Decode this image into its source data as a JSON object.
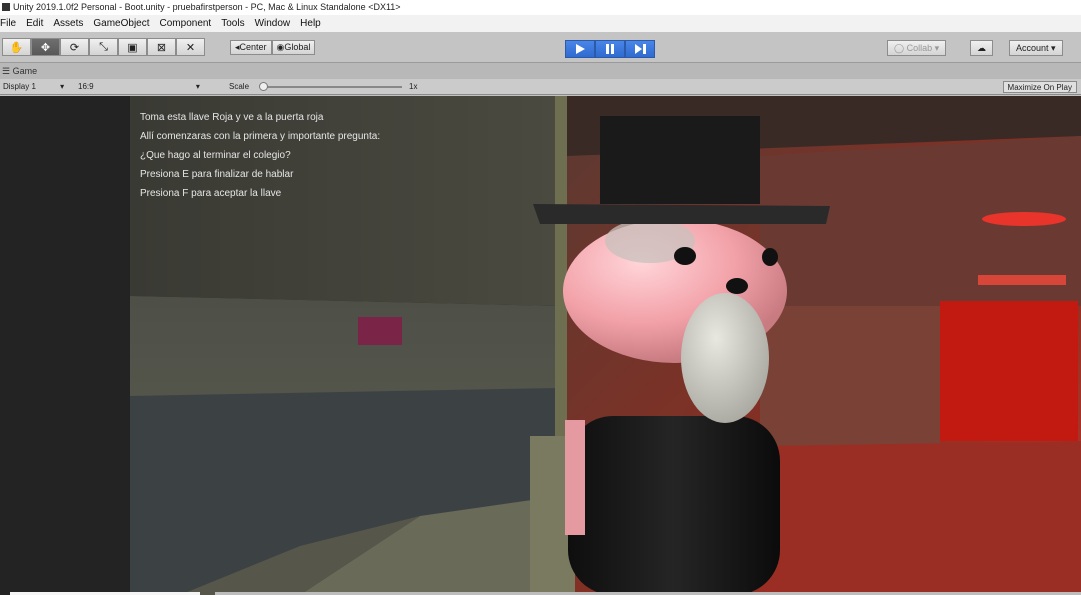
{
  "window": {
    "title": "Unity 2019.1.0f2 Personal - Boot.unity - pruebafirstperson - PC, Mac & Linux Standalone <DX11>"
  },
  "menu": [
    "File",
    "Edit",
    "Assets",
    "GameObject",
    "Component",
    "Tools",
    "Window",
    "Help"
  ],
  "toolbar": {
    "tools": [
      {
        "name": "hand-tool",
        "glyph": "✋"
      },
      {
        "name": "move-tool",
        "glyph": "✥"
      },
      {
        "name": "rotate-tool",
        "glyph": "⟳"
      },
      {
        "name": "scale-tool",
        "glyph": "⤡"
      },
      {
        "name": "rect-tool",
        "glyph": "▣"
      },
      {
        "name": "transform-tool",
        "glyph": "⊠"
      },
      {
        "name": "custom-tool",
        "glyph": "✕"
      }
    ],
    "active_tool_index": 1,
    "pivot_label": "Center",
    "space_label": "Global",
    "collab_label": "Collab",
    "account_label": "Account"
  },
  "tabs": {
    "game_tab": "Game"
  },
  "gamebar": {
    "display": "Display 1",
    "aspect": "16:9",
    "scale_label": "Scale",
    "scale_value": "1x",
    "maximize": "Maximize On Play"
  },
  "dialog": {
    "lines": [
      "Toma esta llave Roja y ve a la puerta roja",
      "Allí comenzaras con la primera y importante pregunta:",
      "¿Que hago al terminar el colegio?",
      "Presiona E para finalizar de hablar",
      "Presiona F para aceptar la llave"
    ]
  },
  "colors": {
    "play_active": "#2f6bd0",
    "red_door": "#c21a10",
    "red_light": "#e8342a"
  }
}
